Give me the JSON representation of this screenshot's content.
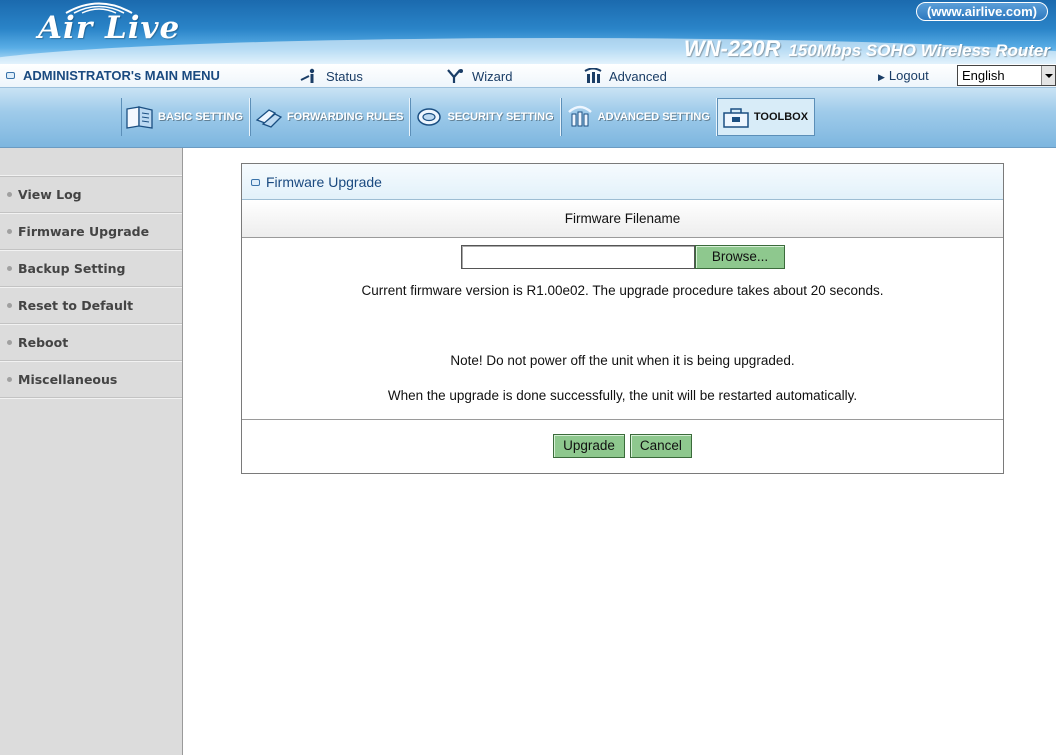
{
  "header": {
    "logo": "Air Live",
    "url": "(www.airlive.com)",
    "model": "WN-220R",
    "product": "150Mbps SOHO Wireless Router"
  },
  "menu": {
    "admin": "ADMINISTRATOR's MAIN MENU",
    "status": "Status",
    "wizard": "Wizard",
    "advanced": "Advanced",
    "logout": "Logout",
    "language": "English"
  },
  "tabs": [
    {
      "label": "BASIC SETTING",
      "icon": "book-icon"
    },
    {
      "label": "FORWARDING RULES",
      "icon": "arrows-icon"
    },
    {
      "label": "SECURITY SETTING",
      "icon": "shield-icon"
    },
    {
      "label": "ADVANCED SETTING",
      "icon": "gear-icon"
    },
    {
      "label": "TOOLBOX",
      "icon": "toolbox-icon",
      "active": true
    }
  ],
  "sidebar": {
    "items": [
      {
        "label": "View Log"
      },
      {
        "label": "Firmware Upgrade"
      },
      {
        "label": "Backup Setting"
      },
      {
        "label": "Reset to Default"
      },
      {
        "label": "Reboot"
      },
      {
        "label": "Miscellaneous"
      }
    ]
  },
  "panel": {
    "title": "Firmware Upgrade",
    "column_header": "Firmware Filename",
    "file_value": "",
    "browse_label": "Browse...",
    "version_text": "Current firmware version is R1.00e02. The upgrade procedure takes about 20 seconds.",
    "note_text": "Note! Do not power off the unit when it is being upgraded.",
    "restart_text": "When the upgrade is done successfully, the unit will be restarted automatically.",
    "upgrade_label": "Upgrade",
    "cancel_label": "Cancel"
  },
  "colors": {
    "banner_blue": "#2a84c8",
    "button_green": "#8ec88e",
    "sidebar_gray": "#dcdcdc"
  }
}
